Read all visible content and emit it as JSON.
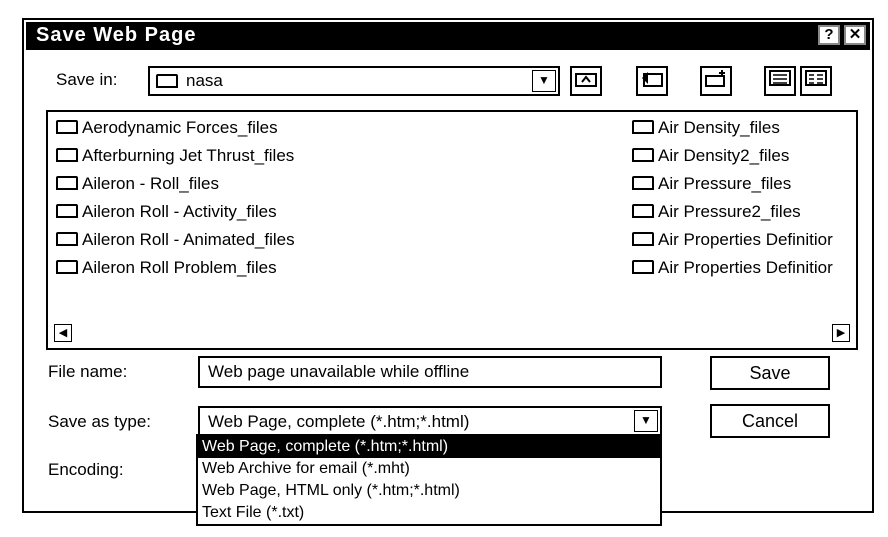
{
  "window": {
    "title": "Save Web Page",
    "help_label": "?",
    "close_label": "✕"
  },
  "save_in": {
    "label": "Save in:",
    "value": "nasa"
  },
  "toolbar": {
    "up_folder_icon": "up-folder-icon",
    "back_icon": "back-icon",
    "new_folder_icon": "new-folder-icon",
    "list_view_icon": "list-view-icon",
    "details_view_icon": "details-view-icon"
  },
  "files_left": [
    "Aerodynamic Forces_files",
    "Afterburning Jet Thrust_files",
    "Aileron - Roll_files",
    "Aileron Roll - Activity_files",
    "Aileron Roll - Animated_files",
    "Aileron Roll Problem_files"
  ],
  "files_right": [
    "Air Density_files",
    "Air Density2_files",
    "Air Pressure_files",
    "Air Pressure2_files",
    "Air Properties Definitior",
    "Air Properties Definitior"
  ],
  "file_name": {
    "label": "File name:",
    "value": "Web page unavailable while offline"
  },
  "save_as_type": {
    "label": "Save as type:",
    "value": "Web Page, complete (*.htm;*.html)",
    "options": [
      "Web Page, complete (*.htm;*.html)",
      "Web Archive for email (*.mht)",
      "Web Page, HTML only (*.htm;*.html)",
      "Text File (*.txt)"
    ]
  },
  "encoding": {
    "label": "Encoding:"
  },
  "buttons": {
    "save": "Save",
    "cancel": "Cancel"
  }
}
